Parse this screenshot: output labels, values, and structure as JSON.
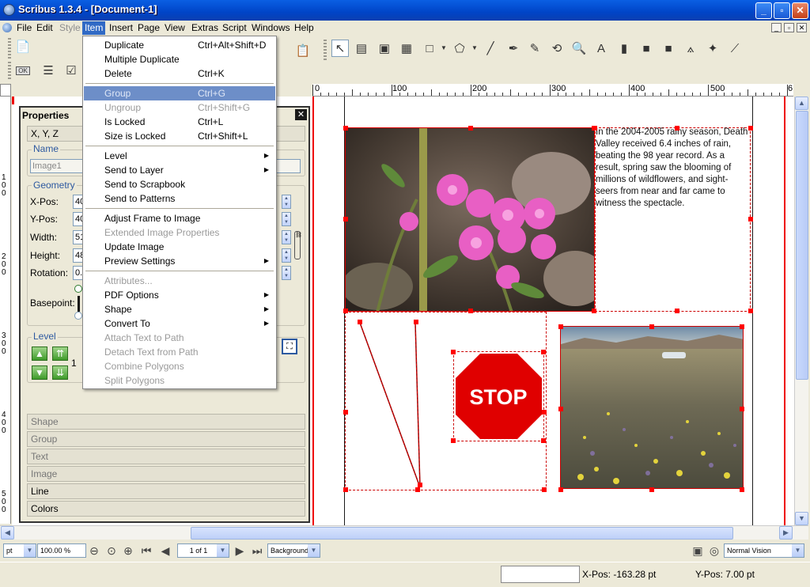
{
  "window": {
    "title": "Scribus 1.3.4 - [Document-1]",
    "min": "_",
    "max": "▫",
    "close": "✕"
  },
  "menubar": {
    "items": [
      "File",
      "Edit",
      "Style",
      "Item",
      "Insert",
      "Page",
      "View",
      "Extras",
      "Script",
      "Windows",
      "Help"
    ],
    "active": "Item",
    "disabled": [
      "Style"
    ]
  },
  "item_menu": {
    "rows": [
      {
        "label": "Duplicate",
        "shortcut": "Ctrl+Alt+Shift+D",
        "enabled": true
      },
      {
        "label": "Multiple Duplicate",
        "shortcut": "",
        "enabled": true
      },
      {
        "label": "Delete",
        "shortcut": "Ctrl+K",
        "enabled": true
      },
      {
        "label": "Group",
        "shortcut": "Ctrl+G",
        "enabled": false,
        "highlighted": true
      },
      {
        "label": "Ungroup",
        "shortcut": "Ctrl+Shift+G",
        "enabled": false
      },
      {
        "label": "Is Locked",
        "shortcut": "Ctrl+L",
        "enabled": true
      },
      {
        "label": "Size is Locked",
        "shortcut": "Ctrl+Shift+L",
        "enabled": true
      },
      {
        "label": "Level",
        "shortcut": "",
        "enabled": true,
        "submenu": true
      },
      {
        "label": "Send to Layer",
        "shortcut": "",
        "enabled": true,
        "submenu": true
      },
      {
        "label": "Send to Scrapbook",
        "shortcut": "",
        "enabled": true
      },
      {
        "label": "Send to Patterns",
        "shortcut": "",
        "enabled": true
      },
      {
        "label": "Adjust Frame to Image",
        "shortcut": "",
        "enabled": true
      },
      {
        "label": "Extended Image Properties",
        "shortcut": "",
        "enabled": false
      },
      {
        "label": "Update Image",
        "shortcut": "",
        "enabled": true
      },
      {
        "label": "Preview Settings",
        "shortcut": "",
        "enabled": true,
        "submenu": true
      },
      {
        "label": "Attributes...",
        "shortcut": "",
        "enabled": false
      },
      {
        "label": "PDF Options",
        "shortcut": "",
        "enabled": true,
        "submenu": true
      },
      {
        "label": "Shape",
        "shortcut": "",
        "enabled": true,
        "submenu": true
      },
      {
        "label": "Convert To",
        "shortcut": "",
        "enabled": true,
        "submenu": true
      },
      {
        "label": "Attach Text to Path",
        "shortcut": "",
        "enabled": false
      },
      {
        "label": "Detach Text from Path",
        "shortcut": "",
        "enabled": false
      },
      {
        "label": "Combine Polygons",
        "shortcut": "",
        "enabled": false
      },
      {
        "label": "Split Polygons",
        "shortcut": "",
        "enabled": false
      }
    ]
  },
  "toolbar": {
    "ok_label": "OK"
  },
  "ruler": {
    "labels": [
      "0",
      "100",
      "200",
      "300",
      "400",
      "500",
      "6"
    ]
  },
  "vruler": {
    "labels": [
      "100",
      "200",
      "300",
      "400",
      "500"
    ]
  },
  "properties": {
    "title": "Properties",
    "close": "✕",
    "tab_xyz": "X, Y, Z",
    "name_group": "Name",
    "name_value": "Image1",
    "geometry_group": "Geometry",
    "xpos_label": "X-Pos:",
    "xpos_value": "40",
    "ypos_label": "Y-Pos:",
    "ypos_value": "40",
    "width_label": "Width:",
    "width_value": "51",
    "height_label": "Height:",
    "height_value": "48",
    "rotation_label": "Rotation:",
    "rotation_value": "0.",
    "basepoint_label": "Basepoint:",
    "level_group": "Level",
    "level_value": "1",
    "tabs": [
      "Shape",
      "Group",
      "Text",
      "Image",
      "Line",
      "Colors"
    ],
    "tabs_enabled": [
      "Line",
      "Colors"
    ]
  },
  "document": {
    "body_text": "In the 2004-2005 rainy season, Death Valley received 6.4 inches of rain, beating the 98 year record. As a result, spring saw the blooming of millions of wildflowers, and sight-seers from near and far came to witness the spectacle.",
    "stop_sign": "STOP"
  },
  "navbar": {
    "unit": "pt",
    "zoom": "100.00 %",
    "page": "1 of 1",
    "layer": "Background",
    "vision": "Normal Vision"
  },
  "status": {
    "xpos": "X-Pos: -163.28 pt",
    "ypos": "Y-Pos: 7.00 pt"
  },
  "colors": {
    "accent": "#316ac5",
    "menu_highlight": "#6d8ec8",
    "frame": "#cc0000",
    "stop": "#e00000"
  }
}
